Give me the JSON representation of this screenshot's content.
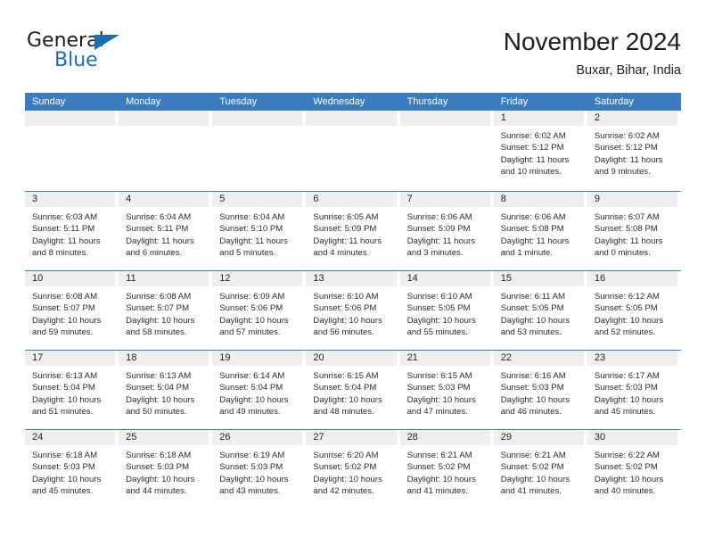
{
  "brand": {
    "name_part1": "General",
    "name_part2": "Blue",
    "accent_color": "#1b6cb3"
  },
  "header": {
    "title": "November 2024",
    "subtitle": "Buxar, Bihar, India"
  },
  "calendar": {
    "header_color": "#3a7cbe",
    "day_band_color": "#efefef",
    "weekdays": [
      "Sunday",
      "Monday",
      "Tuesday",
      "Wednesday",
      "Thursday",
      "Friday",
      "Saturday"
    ],
    "weeks": [
      [
        {
          "day": "",
          "empty": true
        },
        {
          "day": "",
          "empty": true
        },
        {
          "day": "",
          "empty": true
        },
        {
          "day": "",
          "empty": true
        },
        {
          "day": "",
          "empty": true
        },
        {
          "day": "1",
          "sunrise": "Sunrise: 6:02 AM",
          "sunset": "Sunset: 5:12 PM",
          "daylight1": "Daylight: 11 hours",
          "daylight2": "and 10 minutes."
        },
        {
          "day": "2",
          "sunrise": "Sunrise: 6:02 AM",
          "sunset": "Sunset: 5:12 PM",
          "daylight1": "Daylight: 11 hours",
          "daylight2": "and 9 minutes."
        }
      ],
      [
        {
          "day": "3",
          "sunrise": "Sunrise: 6:03 AM",
          "sunset": "Sunset: 5:11 PM",
          "daylight1": "Daylight: 11 hours",
          "daylight2": "and 8 minutes."
        },
        {
          "day": "4",
          "sunrise": "Sunrise: 6:04 AM",
          "sunset": "Sunset: 5:11 PM",
          "daylight1": "Daylight: 11 hours",
          "daylight2": "and 6 minutes."
        },
        {
          "day": "5",
          "sunrise": "Sunrise: 6:04 AM",
          "sunset": "Sunset: 5:10 PM",
          "daylight1": "Daylight: 11 hours",
          "daylight2": "and 5 minutes."
        },
        {
          "day": "6",
          "sunrise": "Sunrise: 6:05 AM",
          "sunset": "Sunset: 5:09 PM",
          "daylight1": "Daylight: 11 hours",
          "daylight2": "and 4 minutes."
        },
        {
          "day": "7",
          "sunrise": "Sunrise: 6:06 AM",
          "sunset": "Sunset: 5:09 PM",
          "daylight1": "Daylight: 11 hours",
          "daylight2": "and 3 minutes."
        },
        {
          "day": "8",
          "sunrise": "Sunrise: 6:06 AM",
          "sunset": "Sunset: 5:08 PM",
          "daylight1": "Daylight: 11 hours",
          "daylight2": "and 1 minute."
        },
        {
          "day": "9",
          "sunrise": "Sunrise: 6:07 AM",
          "sunset": "Sunset: 5:08 PM",
          "daylight1": "Daylight: 11 hours",
          "daylight2": "and 0 minutes."
        }
      ],
      [
        {
          "day": "10",
          "sunrise": "Sunrise: 6:08 AM",
          "sunset": "Sunset: 5:07 PM",
          "daylight1": "Daylight: 10 hours",
          "daylight2": "and 59 minutes."
        },
        {
          "day": "11",
          "sunrise": "Sunrise: 6:08 AM",
          "sunset": "Sunset: 5:07 PM",
          "daylight1": "Daylight: 10 hours",
          "daylight2": "and 58 minutes."
        },
        {
          "day": "12",
          "sunrise": "Sunrise: 6:09 AM",
          "sunset": "Sunset: 5:06 PM",
          "daylight1": "Daylight: 10 hours",
          "daylight2": "and 57 minutes."
        },
        {
          "day": "13",
          "sunrise": "Sunrise: 6:10 AM",
          "sunset": "Sunset: 5:06 PM",
          "daylight1": "Daylight: 10 hours",
          "daylight2": "and 56 minutes."
        },
        {
          "day": "14",
          "sunrise": "Sunrise: 6:10 AM",
          "sunset": "Sunset: 5:05 PM",
          "daylight1": "Daylight: 10 hours",
          "daylight2": "and 55 minutes."
        },
        {
          "day": "15",
          "sunrise": "Sunrise: 6:11 AM",
          "sunset": "Sunset: 5:05 PM",
          "daylight1": "Daylight: 10 hours",
          "daylight2": "and 53 minutes."
        },
        {
          "day": "16",
          "sunrise": "Sunrise: 6:12 AM",
          "sunset": "Sunset: 5:05 PM",
          "daylight1": "Daylight: 10 hours",
          "daylight2": "and 52 minutes."
        }
      ],
      [
        {
          "day": "17",
          "sunrise": "Sunrise: 6:13 AM",
          "sunset": "Sunset: 5:04 PM",
          "daylight1": "Daylight: 10 hours",
          "daylight2": "and 51 minutes."
        },
        {
          "day": "18",
          "sunrise": "Sunrise: 6:13 AM",
          "sunset": "Sunset: 5:04 PM",
          "daylight1": "Daylight: 10 hours",
          "daylight2": "and 50 minutes."
        },
        {
          "day": "19",
          "sunrise": "Sunrise: 6:14 AM",
          "sunset": "Sunset: 5:04 PM",
          "daylight1": "Daylight: 10 hours",
          "daylight2": "and 49 minutes."
        },
        {
          "day": "20",
          "sunrise": "Sunrise: 6:15 AM",
          "sunset": "Sunset: 5:04 PM",
          "daylight1": "Daylight: 10 hours",
          "daylight2": "and 48 minutes."
        },
        {
          "day": "21",
          "sunrise": "Sunrise: 6:15 AM",
          "sunset": "Sunset: 5:03 PM",
          "daylight1": "Daylight: 10 hours",
          "daylight2": "and 47 minutes."
        },
        {
          "day": "22",
          "sunrise": "Sunrise: 6:16 AM",
          "sunset": "Sunset: 5:03 PM",
          "daylight1": "Daylight: 10 hours",
          "daylight2": "and 46 minutes."
        },
        {
          "day": "23",
          "sunrise": "Sunrise: 6:17 AM",
          "sunset": "Sunset: 5:03 PM",
          "daylight1": "Daylight: 10 hours",
          "daylight2": "and 45 minutes."
        }
      ],
      [
        {
          "day": "24",
          "sunrise": "Sunrise: 6:18 AM",
          "sunset": "Sunset: 5:03 PM",
          "daylight1": "Daylight: 10 hours",
          "daylight2": "and 45 minutes."
        },
        {
          "day": "25",
          "sunrise": "Sunrise: 6:18 AM",
          "sunset": "Sunset: 5:03 PM",
          "daylight1": "Daylight: 10 hours",
          "daylight2": "and 44 minutes."
        },
        {
          "day": "26",
          "sunrise": "Sunrise: 6:19 AM",
          "sunset": "Sunset: 5:03 PM",
          "daylight1": "Daylight: 10 hours",
          "daylight2": "and 43 minutes."
        },
        {
          "day": "27",
          "sunrise": "Sunrise: 6:20 AM",
          "sunset": "Sunset: 5:02 PM",
          "daylight1": "Daylight: 10 hours",
          "daylight2": "and 42 minutes."
        },
        {
          "day": "28",
          "sunrise": "Sunrise: 6:21 AM",
          "sunset": "Sunset: 5:02 PM",
          "daylight1": "Daylight: 10 hours",
          "daylight2": "and 41 minutes."
        },
        {
          "day": "29",
          "sunrise": "Sunrise: 6:21 AM",
          "sunset": "Sunset: 5:02 PM",
          "daylight1": "Daylight: 10 hours",
          "daylight2": "and 41 minutes."
        },
        {
          "day": "30",
          "sunrise": "Sunrise: 6:22 AM",
          "sunset": "Sunset: 5:02 PM",
          "daylight1": "Daylight: 10 hours",
          "daylight2": "and 40 minutes."
        }
      ]
    ]
  }
}
